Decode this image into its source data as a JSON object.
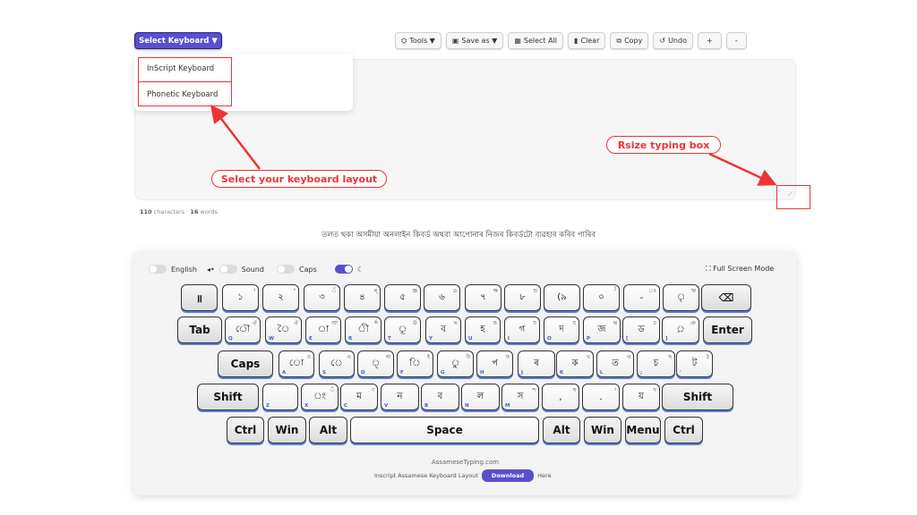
{
  "header": {
    "select_keyboard": "Select Keyboard ▼",
    "buttons": [
      {
        "icon": "toolbox-icon",
        "glyph": "⛭",
        "label": "Tools ▼"
      },
      {
        "icon": "save-icon",
        "glyph": "▣",
        "label": "Save as ▼"
      },
      {
        "icon": "select-all-icon",
        "glyph": "▦",
        "label": "Select All"
      },
      {
        "icon": "trash-icon",
        "glyph": "▮",
        "label": "Clear"
      },
      {
        "icon": "copy-icon",
        "glyph": "⧉",
        "label": "Copy"
      },
      {
        "icon": "undo-icon",
        "glyph": "↺",
        "label": "Undo"
      },
      {
        "icon": "zoom-in-icon",
        "glyph": "",
        "label": "+"
      },
      {
        "icon": "zoom-out-icon",
        "glyph": "",
        "label": "-"
      }
    ]
  },
  "dropdown": {
    "items": [
      "InScript Keyboard",
      "Phonetic Keyboard"
    ]
  },
  "annotations": {
    "layout": "Select your keyboard layout",
    "resize": "Rsize typing box"
  },
  "counter": {
    "characters_count": "110",
    "characters_label": "characters",
    "sep": "·",
    "words_count": "16",
    "words_label": "words"
  },
  "subtitle": "তলত থকা অসমীয়া অনলাইন কিবৰ্ড অথবা আপোনাৰ নিজৰ কিবৰ্ডটো ব্যৱহাৰ কৰিব পাৰিব",
  "options": {
    "english": "English",
    "sound_icon": "◂•",
    "sound": "Sound",
    "caps": "Caps",
    "moon_icon": "☾",
    "fullscreen_icon": "⛶",
    "fullscreen": "Full Screen Mode"
  },
  "keyboard": {
    "rows": [
      [
        {
          "m": "॥",
          "s": "",
          "e": ""
        },
        {
          "m": "১",
          "s": "।",
          "e": ""
        },
        {
          "m": "২",
          "s": "॰",
          "e": ""
        },
        {
          "m": "৩",
          "s": "ঁ",
          "e": ""
        },
        {
          "m": "৪",
          "s": "ৰ্",
          "e": ""
        },
        {
          "m": "৫",
          "s": "জ্ঞ",
          "e": ""
        },
        {
          "m": "৬",
          "s": "ত্ৰ",
          "e": ""
        },
        {
          "m": "৭",
          "s": "ক্ষ",
          "e": ""
        },
        {
          "m": "৮",
          "s": "শ্ৰ",
          "e": ""
        },
        {
          "m": "(৯",
          "s": "",
          "e": ""
        },
        {
          "m": "০",
          "s": ")",
          "e": ""
        },
        {
          "m": "-",
          "s": "ঃ",
          "e": ""
        },
        {
          "m": "ৃ",
          "s": "ঋ",
          "e": ""
        },
        {
          "m": "⌫",
          "s": "",
          "e": ""
        }
      ],
      [
        {
          "m": "Tab",
          "s": "",
          "e": ""
        },
        {
          "m": "ৌ",
          "s": "ঔ",
          "e": "Q"
        },
        {
          "m": "ৈ",
          "s": "ঐ",
          "e": "W"
        },
        {
          "m": "া",
          "s": "আ",
          "e": "E"
        },
        {
          "m": "ী",
          "s": "ঈ",
          "e": "R"
        },
        {
          "m": "ূ",
          "s": "ঊ",
          "e": "T"
        },
        {
          "m": "ব",
          "s": "ভ",
          "e": "Y"
        },
        {
          "m": "হ",
          "s": "ঙ",
          "e": "U"
        },
        {
          "m": "গ",
          "s": "ঘ",
          "e": "I"
        },
        {
          "m": "দ",
          "s": "ধ",
          "e": "O"
        },
        {
          "m": "জ",
          "s": "ঝ",
          "e": "P"
        },
        {
          "m": "ড",
          "s": "ঢ",
          "e": "["
        },
        {
          "m": "়",
          "s": "ঞ",
          "e": "]"
        },
        {
          "m": "Enter",
          "s": "",
          "e": ""
        }
      ],
      [
        {
          "m": "Caps",
          "s": "",
          "e": ""
        },
        {
          "m": "ো",
          "s": "ও",
          "e": "A"
        },
        {
          "m": "ে",
          "s": "এ",
          "e": "S"
        },
        {
          "m": "্",
          "s": "অ",
          "e": "D"
        },
        {
          "m": "ি",
          "s": "ই",
          "e": "F"
        },
        {
          "m": "ু",
          "s": "উ",
          "e": "G"
        },
        {
          "m": "প",
          "s": "ফ",
          "e": "H"
        },
        {
          "m": "ৰ",
          "s": "",
          "e": "J"
        },
        {
          "m": "ক",
          "s": "খ",
          "e": "K"
        },
        {
          "m": "ত",
          "s": "থ",
          "e": "L"
        },
        {
          "m": "চ",
          "s": "ছ",
          "e": ";"
        },
        {
          "m": "ট",
          "s": "ঠ",
          "e": "'"
        }
      ],
      [
        {
          "m": "Shift",
          "s": "",
          "e": ""
        },
        {
          "m": "",
          "s": "",
          "e": "Z"
        },
        {
          "m": "ং",
          "s": "ঁ",
          "e": "X"
        },
        {
          "m": "ম",
          "s": "ণ",
          "e": "C"
        },
        {
          "m": "ন",
          "s": "",
          "e": "V"
        },
        {
          "m": "ব",
          "s": "",
          "e": "B"
        },
        {
          "m": "ল",
          "s": "",
          "e": "N"
        },
        {
          "m": "স",
          "s": "শ",
          "e": "M"
        },
        {
          "m": ",",
          "s": "ষ",
          "e": ""
        },
        {
          "m": ".",
          "s": "।",
          "e": ""
        },
        {
          "m": "য়",
          "s": "য",
          "e": ""
        },
        {
          "m": "Shift",
          "s": "",
          "e": ""
        }
      ],
      [
        {
          "m": "Ctrl",
          "s": "",
          "e": ""
        },
        {
          "m": "Win",
          "s": "",
          "e": ""
        },
        {
          "m": "Alt",
          "s": "",
          "e": ""
        },
        {
          "m": "Space",
          "s": "",
          "e": ""
        },
        {
          "m": "Alt",
          "s": "",
          "e": ""
        },
        {
          "m": "Win",
          "s": "",
          "e": ""
        },
        {
          "m": "Menu",
          "s": "",
          "e": ""
        },
        {
          "m": "Ctrl",
          "s": "",
          "e": ""
        }
      ]
    ]
  },
  "footer": {
    "site": "AssameseTyping.com",
    "text_before": "Inscript Assamese Keyboard Layout",
    "download": "Download",
    "text_after": "Here"
  }
}
